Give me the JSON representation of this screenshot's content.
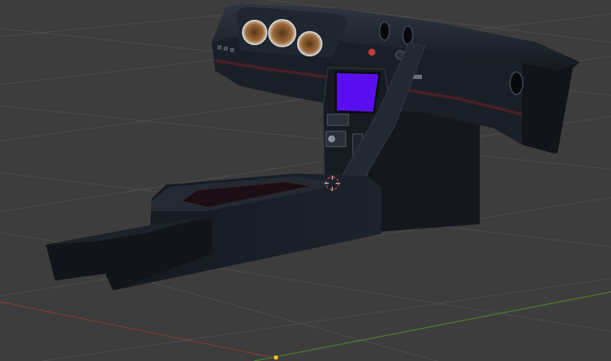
{
  "colors": {
    "viewport_background": "#3d3d3d",
    "grid_line": "#4f4f4f",
    "axis_x": "#8a3a3a",
    "axis_y": "#4f8a22",
    "model_body": "#1a1f27",
    "model_shadow": "#0f1217",
    "model_highlight": "#2b333e",
    "trim_red": "#4a1e28",
    "screen": "#5a10ee",
    "gauge_face": "#c9a070",
    "cursor": "#d83a3a",
    "origin_dot": "#f0c040"
  },
  "icons": {
    "cursor": "3d-cursor-icon",
    "origin": "origin-point-icon"
  },
  "gauges": [
    {
      "name": "left-gauge"
    },
    {
      "name": "center-gauge"
    },
    {
      "name": "right-gauge"
    }
  ]
}
